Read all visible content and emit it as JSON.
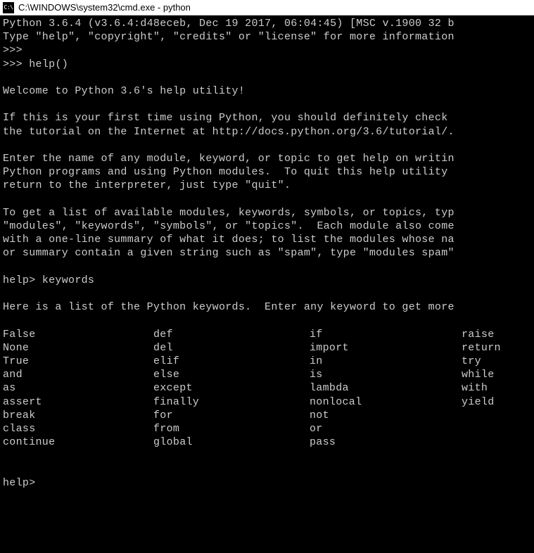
{
  "window": {
    "icon_label": "C:\\",
    "title": "C:\\WINDOWS\\system32\\cmd.exe - python"
  },
  "console": {
    "version_line": "Python 3.6.4 (v3.6.4:d48eceb, Dec 19 2017, 06:04:45) [MSC v.1900 32 b",
    "type_help_line": "Type \"help\", \"copyright\", \"credits\" or \"license\" for more information",
    "prompt1": ">>>",
    "prompt2": ">>> ",
    "help_call": "help()",
    "welcome": "Welcome to Python 3.6's help utility!",
    "para1_line1": "If this is your first time using Python, you should definitely check ",
    "para1_line2": "the tutorial on the Internet at http://docs.python.org/3.6/tutorial/.",
    "para2_line1": "Enter the name of any module, keyword, or topic to get help on writin",
    "para2_line2": "Python programs and using Python modules.  To quit this help utility ",
    "para2_line3": "return to the interpreter, just type \"quit\".",
    "para3_line1": "To get a list of available modules, keywords, symbols, or topics, typ",
    "para3_line2": "\"modules\", \"keywords\", \"symbols\", or \"topics\".  Each module also come",
    "para3_line3": "with a one-line summary of what it does; to list the modules whose na",
    "para3_line4": "or summary contain a given string such as \"spam\", type \"modules spam\"",
    "help_prompt1": "help> ",
    "keywords_cmd": "keywords",
    "keywords_intro": "Here is a list of the Python keywords.  Enter any keyword to get more",
    "keywords": {
      "col1": [
        "False",
        "None",
        "True",
        "and",
        "as",
        "assert",
        "break",
        "class",
        "continue"
      ],
      "col2": [
        "def",
        "del",
        "elif",
        "else",
        "except",
        "finally",
        "for",
        "from",
        "global"
      ],
      "col3": [
        "if",
        "import",
        "in",
        "is",
        "lambda",
        "nonlocal",
        "not",
        "or",
        "pass"
      ],
      "col4": [
        "raise",
        "return",
        "try",
        "while",
        "with",
        "yield",
        "",
        "",
        ""
      ]
    },
    "help_prompt2": "help>"
  }
}
